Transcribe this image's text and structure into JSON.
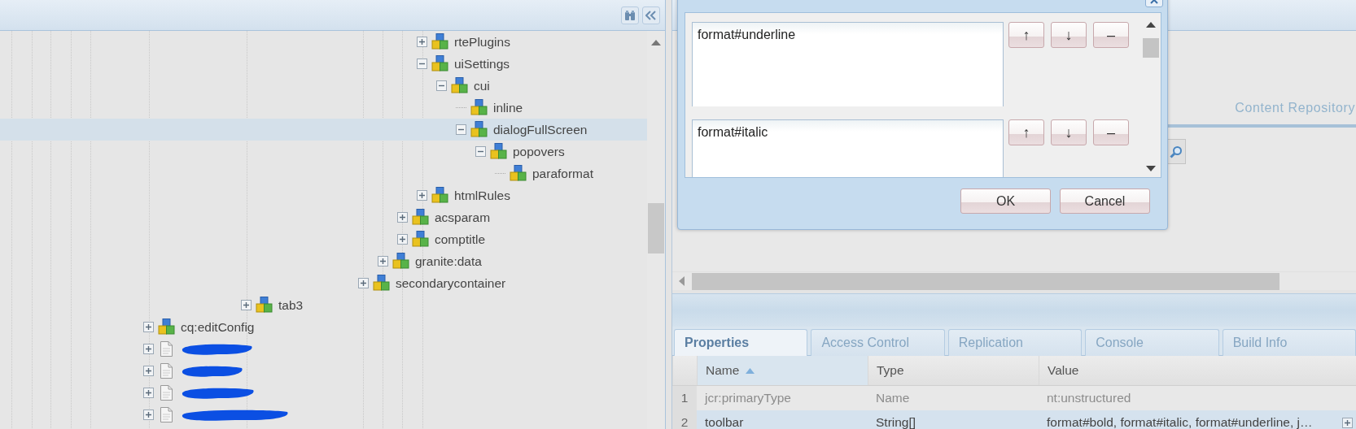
{
  "tree": [
    {
      "children": [
        {
          "children": [
            {
              "children": [
                {
                  "children": [
                    {
                      "children": [
                        {
                          "children": [
                            {
                              "children": [
                                {
                                  "children": [
                                    {
                                      "children": [
                                        {
                                          "children": [
                                            {
                                              "children": [
                                                {
                                                  "children": [
                                                    {
                                                      "children": [
                                                        {
                                                          "children": [
                                                            {
                                                              "label": "rtePlugins",
                                                              "kind": "node",
                                                              "has_children": true,
                                                              "expanded": false,
                                                              "selected": false
                                                            },
                                                            {
                                                              "label": "uiSettings",
                                                              "kind": "node",
                                                              "has_children": true,
                                                              "expanded": true,
                                                              "selected": false,
                                                              "children": [
                                                                {
                                                                  "label": "cui",
                                                                  "kind": "node",
                                                                  "has_children": true,
                                                                  "expanded": true,
                                                                  "selected": false,
                                                                  "children": [
                                                                    {
                                                                      "label": "inline",
                                                                      "kind": "node",
                                                                      "has_children": false,
                                                                      "selected": false
                                                                    },
                                                                    {
                                                                      "label": "dialogFullScreen",
                                                                      "kind": "node",
                                                                      "has_children": true,
                                                                      "expanded": true,
                                                                      "selected": true,
                                                                      "children": [
                                                                        {
                                                                          "label": "popovers",
                                                                          "kind": "node",
                                                                          "has_children": true,
                                                                          "expanded": true,
                                                                          "selected": false,
                                                                          "children": [
                                                                            {
                                                                              "label": "paraformat",
                                                                              "kind": "node",
                                                                              "has_children": false,
                                                                              "selected": false
                                                                            }
                                                                          ]
                                                                        }
                                                                      ]
                                                                    }
                                                                  ]
                                                                }
                                                              ]
                                                            },
                                                            {
                                                              "label": "htmlRules",
                                                              "kind": "node",
                                                              "has_children": true,
                                                              "expanded": false,
                                                              "selected": false
                                                            }
                                                          ]
                                                        },
                                                        {
                                                          "label": "acsparam",
                                                          "kind": "node",
                                                          "has_children": true,
                                                          "expanded": false,
                                                          "selected": false
                                                        },
                                                        {
                                                          "label": "comptitle",
                                                          "kind": "node",
                                                          "has_children": true,
                                                          "expanded": false,
                                                          "selected": false
                                                        }
                                                      ]
                                                    },
                                                    {
                                                      "label": "granite:data",
                                                      "kind": "node",
                                                      "has_children": true,
                                                      "expanded": false,
                                                      "selected": false
                                                    }
                                                  ]
                                                },
                                                {
                                                  "label": "secondarycontainer",
                                                  "kind": "node",
                                                  "has_children": true,
                                                  "expanded": false,
                                                  "selected": false
                                                }
                                              ]
                                            }
                                          ]
                                        }
                                      ]
                                    }
                                  ]
                                }
                              ]
                            }
                          ]
                        },
                        {
                          "label": "tab3",
                          "kind": "node",
                          "has_children": true,
                          "expanded": false,
                          "selected": false
                        }
                      ]
                    }
                  ]
                }
              ]
            }
          ]
        }
      ]
    },
    {
      "label": "cq:editConfig",
      "kind": "node",
      "has_children": true,
      "expanded": false,
      "selected": false
    },
    {
      "kind": "page",
      "has_children": true,
      "expanded": false,
      "redacted": true,
      "selected": false
    },
    {
      "kind": "page",
      "has_children": true,
      "expanded": false,
      "redacted": true,
      "selected": false
    },
    {
      "kind": "page",
      "has_children": true,
      "expanded": false,
      "redacted": true,
      "selected": false
    },
    {
      "kind": "page",
      "has_children": true,
      "expanded": false,
      "redacted": true,
      "selected": false
    }
  ],
  "repository_title": "Content Repository",
  "tabs": [
    {
      "label": "Properties",
      "selected": true
    },
    {
      "label": "Access Control",
      "selected": false
    },
    {
      "label": "Replication",
      "selected": false
    },
    {
      "label": "Console",
      "selected": false
    },
    {
      "label": "Build Info",
      "selected": false
    }
  ],
  "table": {
    "columns": [
      {
        "label": "Name",
        "sorted": true
      },
      {
        "label": "Type",
        "sorted": false
      },
      {
        "label": "Value",
        "sorted": false
      }
    ],
    "rows": [
      {
        "number": "1",
        "name": "jcr:primaryType",
        "type": "Name",
        "value": "nt:unstructured",
        "disabled": true,
        "selected": false,
        "expandable": false
      },
      {
        "number": "2",
        "name": "toolbar",
        "type": "String[]",
        "value": "format#bold, format#italic, format#underline, j…",
        "disabled": false,
        "selected": true,
        "expandable": true
      }
    ]
  },
  "dialog": {
    "items": [
      {
        "value": "format#underline",
        "buttons": [
          "↑",
          "↓",
          "–"
        ]
      },
      {
        "value": "format#italic",
        "buttons": [
          "↑",
          "↓",
          "–"
        ]
      }
    ],
    "buttons": [
      "OK",
      "Cancel"
    ]
  }
}
